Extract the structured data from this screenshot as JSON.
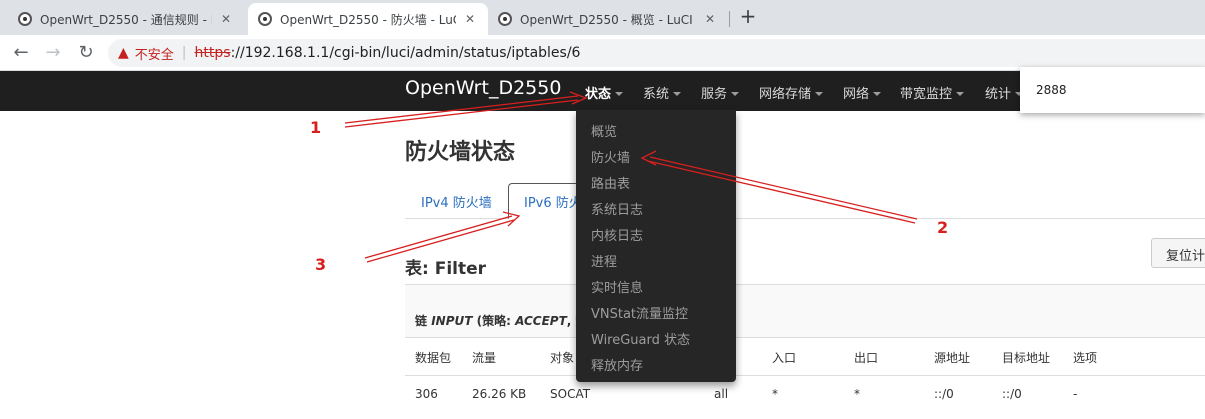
{
  "browser": {
    "tabs": [
      {
        "title": "OpenWrt_D2550 - 通信规则 - Lu"
      },
      {
        "title": "OpenWrt_D2550 - 防火墙 - LuC"
      },
      {
        "title": "OpenWrt_D2550 - 概览 - LuCI"
      }
    ],
    "new_tab": "+",
    "close": "✕",
    "nav": {
      "back": "←",
      "forward": "→",
      "reload": "↻"
    },
    "address": {
      "warning_icon": "▲",
      "insecure_label": "不安全",
      "separator": "|",
      "scheme": "https",
      "rest": "://192.168.1.1/cgi-bin/luci/admin/status/iptables/6"
    }
  },
  "navbar": {
    "brand": "OpenWrt_D2550",
    "menus": [
      "状态",
      "系统",
      "服务",
      "网络存储",
      "网络",
      "带宽监控",
      "统计"
    ]
  },
  "popup": {
    "value": "2888"
  },
  "dropdown": {
    "items": [
      "概览",
      "防火墙",
      "路由表",
      "系统日志",
      "内核日志",
      "进程",
      "实时信息",
      "VNStat流量监控",
      "WireGuard 状态",
      "释放内存"
    ]
  },
  "page": {
    "title": "防火墙状态",
    "tabs": [
      "IPv4 防火墙",
      "IPv6 防火"
    ],
    "reset_button": "复位计",
    "table_title": "表: Filter",
    "chain": {
      "prefix": "链",
      "name": "INPUT",
      "open": " (策略: ",
      "policy": "ACCEPT",
      "tail": ", 数"
    },
    "columns": [
      "数据包",
      "流量",
      "对象",
      "",
      "入口",
      "出口",
      "源地址",
      "目标地址",
      "选项"
    ],
    "rows": [
      [
        "306",
        "26.26 KB",
        "SOCAT",
        "all",
        "*",
        "*",
        "::/0",
        "::/0",
        "-"
      ]
    ]
  },
  "annotations": [
    "1",
    "2",
    "3"
  ],
  "colors": {
    "annotation": "#d71f1f",
    "navbar": "#1f1f1f",
    "link": "#2a6fbf"
  }
}
